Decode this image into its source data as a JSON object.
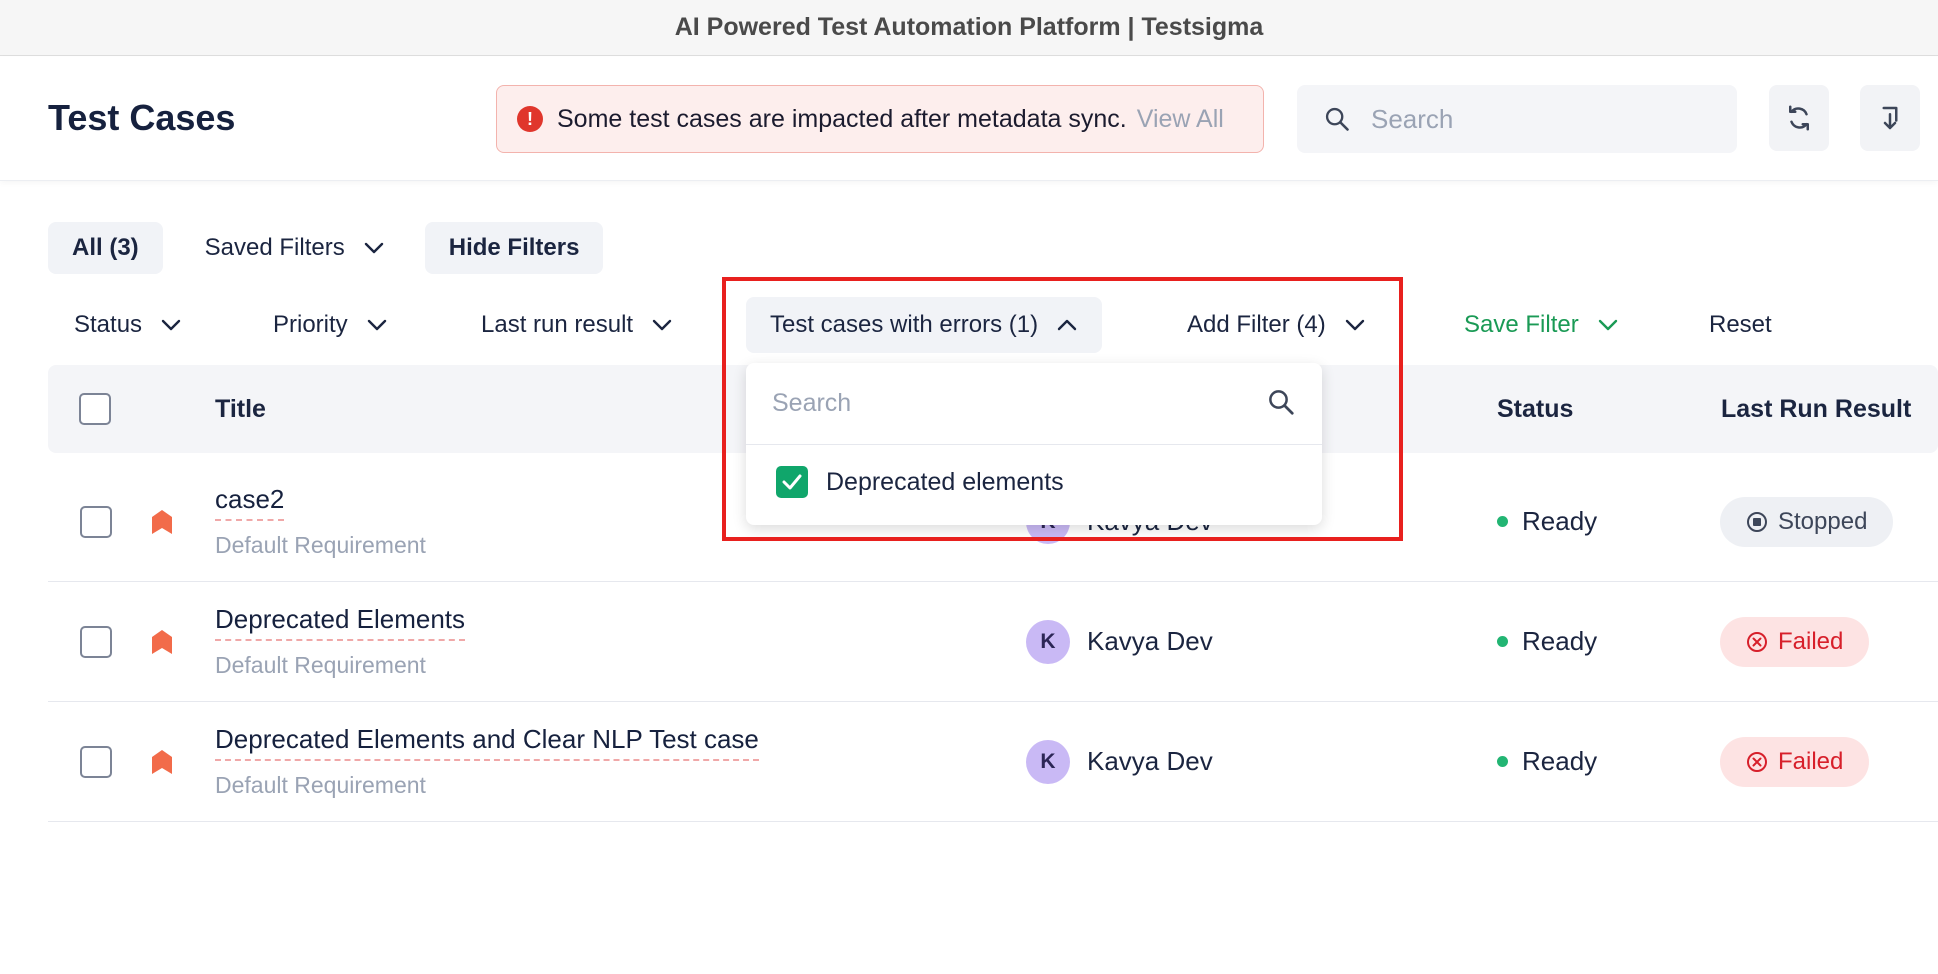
{
  "window": {
    "title": "AI Powered Test Automation Platform | Testsigma"
  },
  "header": {
    "page_title": "Test Cases",
    "alert": {
      "message": "Some test cases are impacted after metadata sync.",
      "link": "View All",
      "icon": "exclamation-icon"
    },
    "search": {
      "placeholder": "Search"
    },
    "actions": [
      {
        "icon": "refresh-icon"
      },
      {
        "icon": "import-icon"
      }
    ]
  },
  "toolbar": {
    "all_label": "All (3)",
    "saved_filters_label": "Saved Filters",
    "hide_filters_label": "Hide Filters"
  },
  "filters": {
    "status": "Status",
    "priority": "Priority",
    "last_run_result": "Last run result",
    "errors": "Test cases with errors (1)",
    "add_filter": "Add Filter (4)",
    "save_filter": "Save Filter",
    "reset": "Reset"
  },
  "dropdown": {
    "search_placeholder": "Search",
    "options": [
      {
        "label": "Deprecated elements",
        "checked": true
      }
    ]
  },
  "table": {
    "columns": {
      "title": "Title",
      "status": "Status",
      "last_run_result": "Last Run Result"
    },
    "rows": [
      {
        "title": "case2",
        "requirement": "Default Requirement",
        "owner_initial": "K",
        "owner": "Kavya Dev",
        "status": "Ready",
        "result": "Stopped"
      },
      {
        "title": "Deprecated Elements",
        "requirement": "Default Requirement",
        "owner_initial": "K",
        "owner": "Kavya Dev",
        "status": "Ready",
        "result": "Failed"
      },
      {
        "title": "Deprecated Elements and Clear NLP Test case",
        "requirement": "Default Requirement",
        "owner_initial": "K",
        "owner": "Kavya Dev",
        "status": "Ready",
        "result": "Failed"
      }
    ]
  },
  "colors": {
    "accent_green": "#1a9a55",
    "failed_red": "#d7202b",
    "alert_red": "#e0362c",
    "highlight": "#e8201e"
  }
}
